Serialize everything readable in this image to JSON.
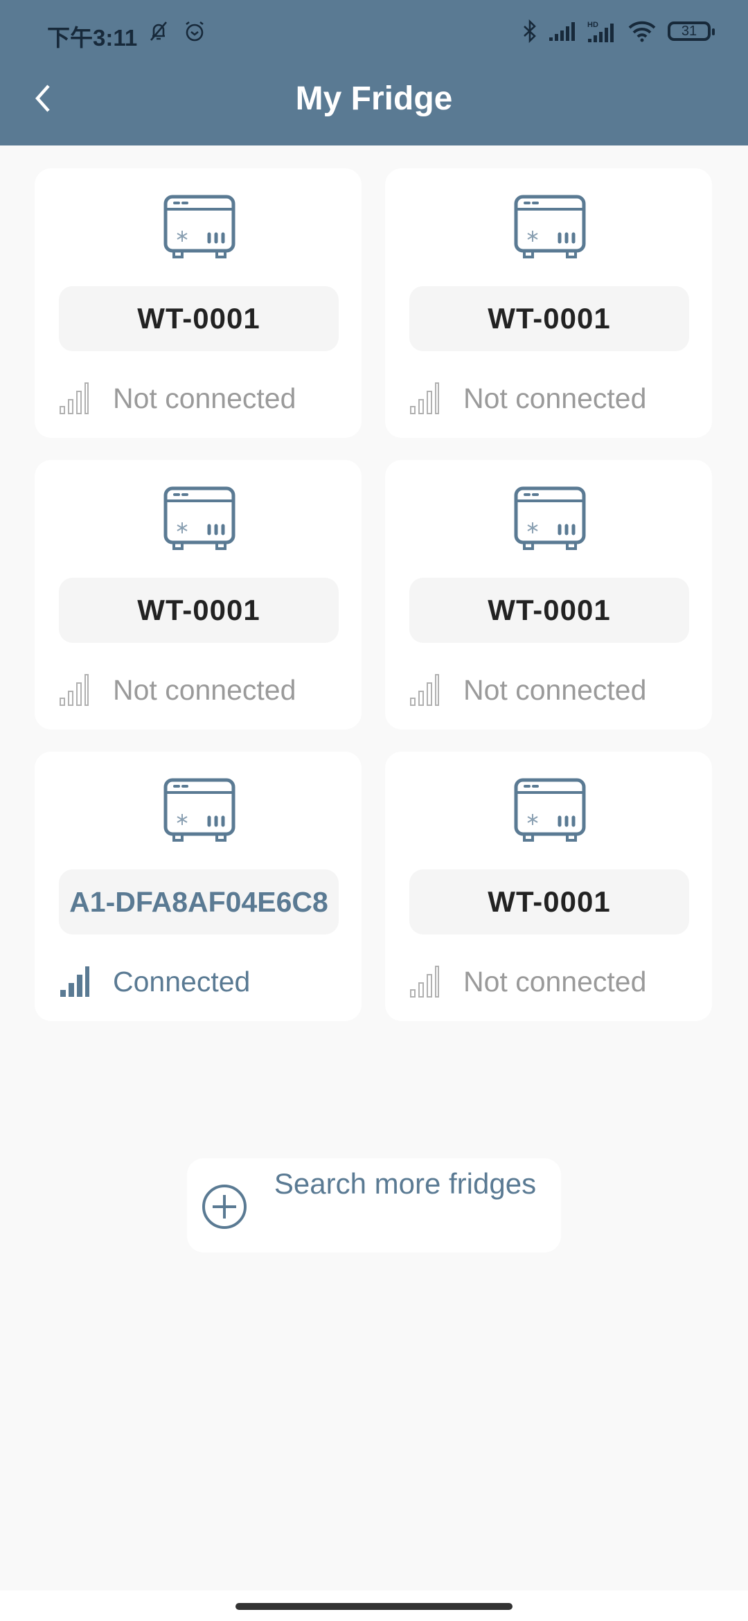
{
  "status_bar": {
    "time": "下午3:11",
    "left_icons": [
      "bell-muted-icon",
      "alarm-icon"
    ],
    "right_icons": [
      "bluetooth-icon",
      "signal-icon",
      "hd-signal-icon",
      "wifi-icon",
      "battery-icon"
    ],
    "battery_level": "31"
  },
  "header": {
    "back_icon": "chevron-left-icon",
    "title": "My Fridge"
  },
  "colors": {
    "primary": "#5a7a93",
    "background": "#f9f9f9",
    "card": "#ffffff",
    "muted_text": "#9a9a9a"
  },
  "devices": [
    {
      "name": "WT-0001",
      "status": "Not connected",
      "connected": false
    },
    {
      "name": "WT-0001",
      "status": "Not connected",
      "connected": false
    },
    {
      "name": "WT-0001",
      "status": "Not connected",
      "connected": false
    },
    {
      "name": "WT-0001",
      "status": "Not connected",
      "connected": false
    },
    {
      "name": "A1-DFA8AF04E6C8",
      "status": "Connected",
      "connected": true
    },
    {
      "name": "WT-0001",
      "status": "Not connected",
      "connected": false
    }
  ],
  "search_button": {
    "label": "Search more fridges",
    "icon": "plus-circle-icon"
  }
}
